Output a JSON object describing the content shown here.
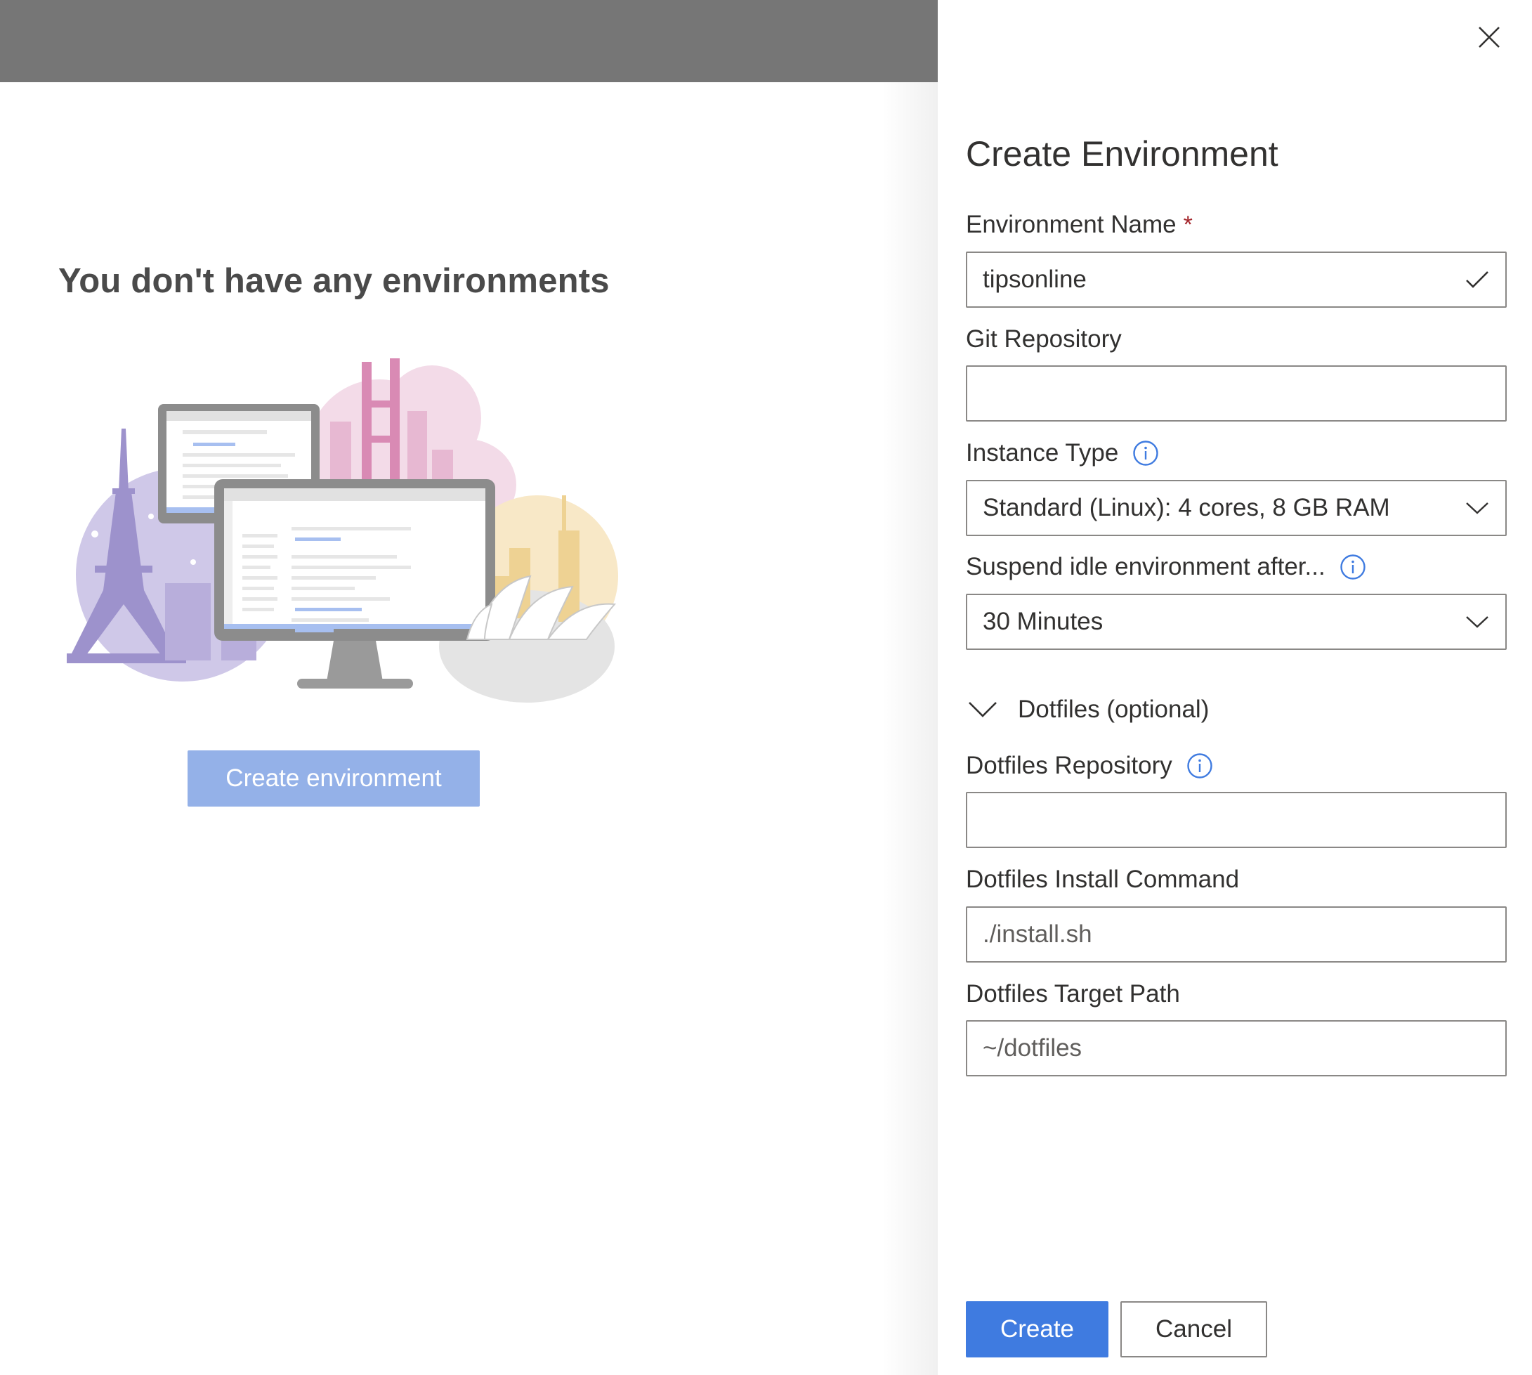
{
  "background": {
    "empty_title": "You don't have any environments",
    "create_environment_button": "Create environment"
  },
  "panel": {
    "title": "Create Environment",
    "close_icon": "close-icon",
    "fields": {
      "environment_name": {
        "label": "Environment Name",
        "required_marker": "*",
        "value": "tipsonline",
        "status_icon": "checkmark-icon"
      },
      "git_repository": {
        "label": "Git Repository",
        "value": ""
      },
      "instance_type": {
        "label": "Instance Type",
        "info_icon": "info-icon",
        "selected": "Standard (Linux): 4 cores, 8 GB RAM"
      },
      "suspend_idle": {
        "label": "Suspend idle environment after...",
        "info_icon": "info-icon",
        "selected": "30 Minutes"
      },
      "dotfiles_section": {
        "label": "Dotfiles (optional)",
        "expanded": true
      },
      "dotfiles_repository": {
        "label": "Dotfiles Repository",
        "info_icon": "info-icon",
        "value": ""
      },
      "dotfiles_install_command": {
        "label": "Dotfiles Install Command",
        "placeholder": "./install.sh"
      },
      "dotfiles_target_path": {
        "label": "Dotfiles Target Path",
        "placeholder": "~/dotfiles"
      }
    },
    "buttons": {
      "create": "Create",
      "cancel": "Cancel"
    }
  },
  "colors": {
    "accent": "#3f7be0",
    "accent_disabled": "#94b1e8",
    "info_blue": "#3f7be0",
    "required_red": "#a4262c",
    "header_gray": "#767676"
  }
}
